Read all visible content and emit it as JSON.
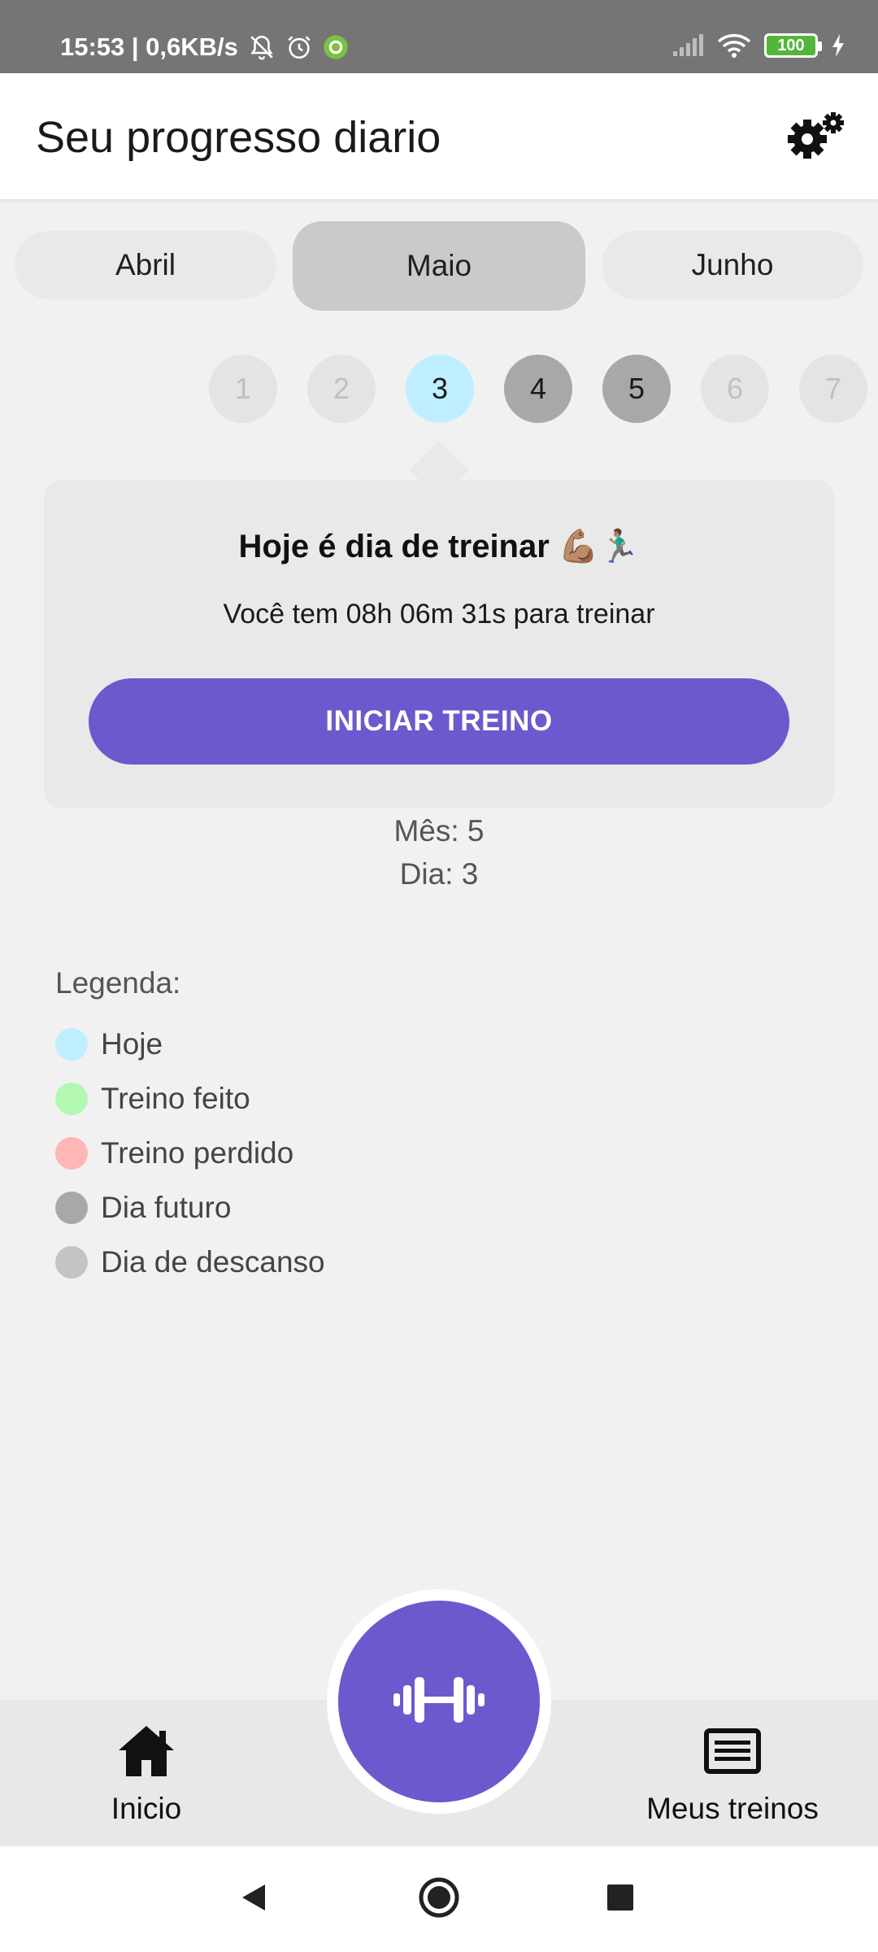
{
  "status_bar": {
    "time_speed": "15:53 | 0,6KB/s",
    "battery": "100",
    "icons": [
      "bell-off-icon",
      "alarm-icon",
      "app-notification-icon",
      "signal-icon",
      "wifi-icon",
      "battery-icon",
      "charging-icon"
    ]
  },
  "app_bar": {
    "title": "Seu progresso diario",
    "settings_icon": "gear-icon"
  },
  "months": [
    "Abril",
    "Maio",
    "Junho"
  ],
  "selected_month": "Maio",
  "days": [
    {
      "label": "1",
      "state": "rest"
    },
    {
      "label": "2",
      "state": "rest"
    },
    {
      "label": "3",
      "state": "today"
    },
    {
      "label": "4",
      "state": "future"
    },
    {
      "label": "5",
      "state": "future"
    },
    {
      "label": "6",
      "state": "rest"
    },
    {
      "label": "7",
      "state": "rest"
    }
  ],
  "card": {
    "title": "Hoje é dia de treinar 💪🏽🏃🏽‍♂️",
    "subtitle": "Você tem 08h 06m 31s para treinar",
    "button": "INICIAR TREINO"
  },
  "info": {
    "month": "Mês: 5",
    "day": "Dia: 3"
  },
  "legend": {
    "title": "Legenda:",
    "items": [
      {
        "label": "Hoje",
        "color": "#bfefff"
      },
      {
        "label": "Treino feito",
        "color": "#b2f7b2"
      },
      {
        "label": "Treino perdido",
        "color": "#ffb6b6"
      },
      {
        "label": "Dia futuro",
        "color": "#a8a8a8"
      },
      {
        "label": "Dia de descanso",
        "color": "#c4c4c4"
      }
    ]
  },
  "bottom_nav": {
    "home": "Inicio",
    "workouts": "Meus treinos",
    "fab_icon": "dumbbell-icon"
  },
  "colors": {
    "accent": "#6a5acd",
    "today": "#bfefff",
    "future": "#a8a8a8"
  }
}
